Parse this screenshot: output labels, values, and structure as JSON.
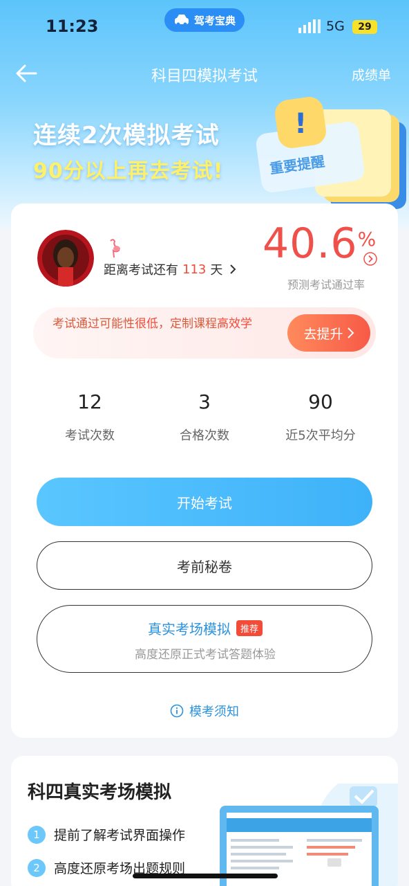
{
  "status_bar": {
    "time": "11:23",
    "app_name": "驾考宝典",
    "network": "5G",
    "battery": "29"
  },
  "nav": {
    "title": "科目四模拟考试",
    "right_link": "成绩单"
  },
  "banner": {
    "line1": "连续2次模拟考试",
    "line2": "90分以上再去考试!",
    "art_text": "重要提醒"
  },
  "profile": {
    "countdown_prefix": "距离考试还有",
    "days": "113",
    "countdown_suffix": "天"
  },
  "prediction": {
    "value": "40.6",
    "unit": "%",
    "label": "预测考试通过率"
  },
  "tip": {
    "part1": "考试通过可能性",
    "highlight1": "很低",
    "part2": "，定制课程",
    "highlight2": "高效学",
    "button": "去提升"
  },
  "stats": [
    {
      "value": "12",
      "label": "考试次数"
    },
    {
      "value": "3",
      "label": "合格次数"
    },
    {
      "value": "90",
      "label": "近5次平均分"
    }
  ],
  "buttons": {
    "start": "开始考试",
    "secret": "考前秘卷",
    "sim_title": "真实考场模拟",
    "sim_badge": "推荐",
    "sim_sub": "高度还原正式考试答题体验",
    "notice": "模考须知"
  },
  "section2": {
    "title": "科四真实考场模拟",
    "features": [
      {
        "num": "1",
        "text": "提前了解考试界面操作"
      },
      {
        "num": "2",
        "text": "高度还原考场出题规则"
      }
    ]
  },
  "colors": {
    "accent_blue": "#3eb2f9",
    "warning_red": "#f24b38",
    "banner_yellow": "#fff06a"
  }
}
